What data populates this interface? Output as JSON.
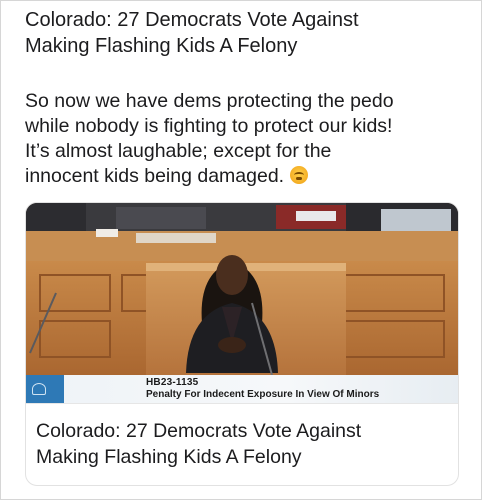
{
  "post": {
    "title_line1": "Colorado: 27 Democrats Vote Against",
    "title_line2": "Making Flashing Kids A Felony",
    "body_line1": "So now we have dems protecting the pedo",
    "body_line2": "while nobody is fighting to protect our kids!",
    "body_line3": "It’s almost laughable; except for the",
    "body_line4": "innocent kids being damaged.",
    "emoji_icon": "exploding-head-icon"
  },
  "link_card": {
    "chyron": {
      "bill_number": "HB23-1135",
      "description": "Penalty For Indecent Exposure In View Of Minors"
    },
    "title_line1": "Colorado: 27 Democrats Vote Against",
    "title_line2": "Making Flashing Kids A Felony"
  }
}
